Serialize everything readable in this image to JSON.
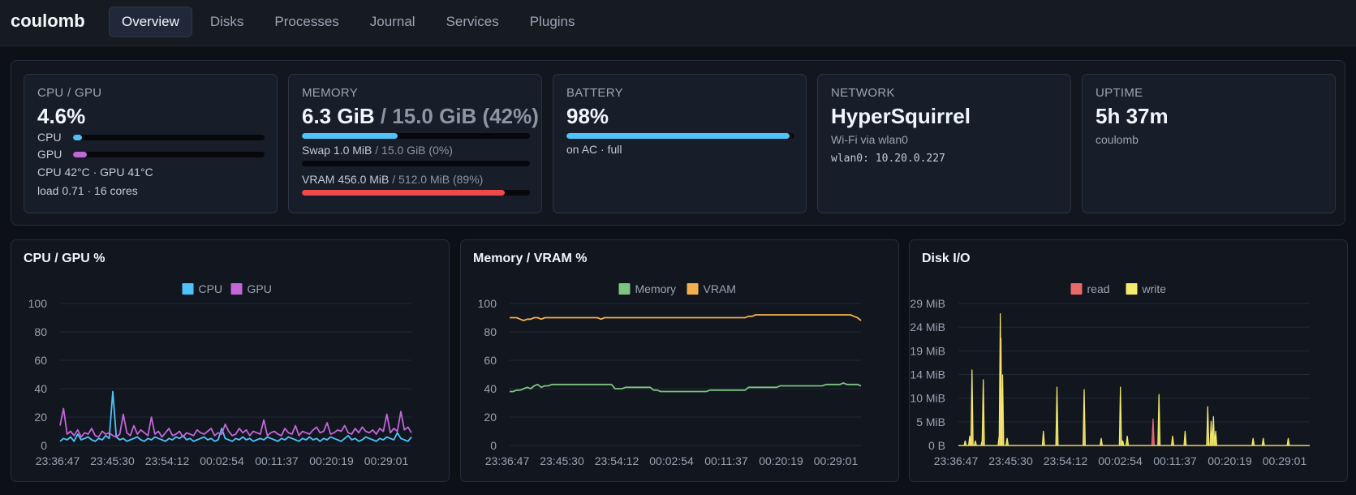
{
  "app": {
    "name": "coulomb"
  },
  "tabs": [
    {
      "label": "Overview",
      "active": true
    },
    {
      "label": "Disks"
    },
    {
      "label": "Processes"
    },
    {
      "label": "Journal"
    },
    {
      "label": "Services"
    },
    {
      "label": "Plugins"
    }
  ],
  "cpu_gpu": {
    "title": "CPU / GPU",
    "value": "4.6%",
    "cpu_label": "CPU",
    "cpu_fraction": 0.046,
    "gpu_label": "GPU",
    "gpu_fraction": 0.07,
    "temps": "CPU 42°C · GPU 41°C",
    "load": "load 0.71 · 16 cores"
  },
  "memory": {
    "title": "MEMORY",
    "used": "6.3 GiB",
    "total": "/ 15.0 GiB (42%)",
    "fraction": 0.42,
    "swap_used": "Swap 1.0 MiB",
    "swap_total": "/ 15.0 GiB (0%)",
    "swap_fraction": 0.0,
    "vram_used": "VRAM 456.0 MiB",
    "vram_total": "/ 512.0 MiB (89%)",
    "vram_fraction": 0.89
  },
  "battery": {
    "title": "BATTERY",
    "value": "98%",
    "fraction": 0.98,
    "status": "on AC · full"
  },
  "network": {
    "title": "NETWORK",
    "ssid": "HyperSquirrel",
    "via": "Wi-Fi via wlan0",
    "address": "wlan0: 10.20.0.227"
  },
  "uptime": {
    "title": "UPTIME",
    "value": "5h 37m",
    "host": "coulomb"
  },
  "colors": {
    "cpu": "#4fc3f7",
    "gpu": "#c266d8",
    "memory": "#7cc47f",
    "vram": "#f4b04d",
    "read": "#e86a6a",
    "write": "#f5ea6b",
    "vram_bar": "#ef4a4a"
  },
  "chart_data": [
    {
      "type": "line",
      "title": "CPU / GPU %",
      "x_ticks": [
        "23:36:47",
        "23:45:30",
        "23:54:12",
        "00:02:54",
        "00:11:37",
        "00:20:19",
        "00:29:01"
      ],
      "y_ticks": [
        "0",
        "20",
        "40",
        "60",
        "80",
        "100"
      ],
      "ylim": [
        0,
        100
      ],
      "legend_position": "top-center",
      "grid": true,
      "series": [
        {
          "name": "CPU",
          "color": "#4fc3f7",
          "values": [
            3,
            5,
            4,
            6,
            3,
            8,
            4,
            5,
            6,
            4,
            3,
            5,
            4,
            7,
            5,
            38,
            6,
            4,
            5,
            3,
            4,
            5,
            6,
            4,
            3,
            5,
            4,
            6,
            5,
            4,
            3,
            5,
            4,
            6,
            5,
            7,
            4,
            5,
            3,
            4,
            5,
            6,
            4,
            5,
            3,
            4,
            12,
            5,
            4,
            3,
            5,
            4,
            6,
            4,
            5,
            3,
            4,
            5,
            4,
            6,
            5,
            4,
            3,
            5,
            4,
            6,
            5,
            4,
            3,
            5,
            4,
            6,
            4,
            5,
            3,
            5,
            4,
            6,
            5,
            4,
            3,
            5,
            7,
            4,
            5,
            3,
            4,
            6,
            5,
            4,
            3,
            5,
            4,
            6,
            5,
            4,
            9,
            5,
            4,
            3,
            6
          ]
        },
        {
          "name": "GPU",
          "color": "#c266d8",
          "values": [
            14,
            26,
            8,
            10,
            7,
            11,
            6,
            9,
            8,
            12,
            7,
            6,
            10,
            8,
            9,
            7,
            6,
            8,
            22,
            9,
            7,
            14,
            8,
            11,
            9,
            7,
            20,
            8,
            10,
            6,
            9,
            12,
            7,
            8,
            10,
            6,
            9,
            8,
            7,
            11,
            9,
            8,
            10,
            12,
            7,
            9,
            8,
            15,
            10,
            7,
            8,
            12,
            9,
            11,
            7,
            10,
            9,
            8,
            18,
            7,
            9,
            10,
            8,
            7,
            12,
            9,
            8,
            14,
            7,
            10,
            9,
            8,
            11,
            13,
            9,
            10,
            16,
            8,
            9,
            11,
            10,
            14,
            9,
            8,
            12,
            9,
            13,
            10,
            9,
            11,
            8,
            12,
            10,
            22,
            9,
            12,
            10,
            24,
            11,
            13,
            9
          ]
        }
      ]
    },
    {
      "type": "line",
      "title": "Memory / VRAM %",
      "x_ticks": [
        "23:36:47",
        "23:45:30",
        "23:54:12",
        "00:02:54",
        "00:11:37",
        "00:20:19",
        "00:29:01"
      ],
      "y_ticks": [
        "0",
        "20",
        "40",
        "60",
        "80",
        "100"
      ],
      "ylim": [
        0,
        100
      ],
      "legend_position": "top-center",
      "grid": true,
      "series": [
        {
          "name": "Memory",
          "color": "#7cc47f",
          "values": [
            38,
            38,
            39,
            39,
            40,
            41,
            40,
            42,
            43,
            41,
            42,
            42,
            43,
            43,
            43,
            43,
            43,
            43,
            43,
            43,
            43,
            43,
            43,
            43,
            43,
            43,
            43,
            43,
            43,
            43,
            40,
            40,
            40,
            41,
            41,
            41,
            41,
            41,
            41,
            41,
            41,
            39,
            39,
            38,
            38,
            38,
            38,
            38,
            38,
            38,
            38,
            38,
            38,
            38,
            38,
            38,
            38,
            39,
            39,
            39,
            39,
            39,
            39,
            39,
            39,
            39,
            39,
            39,
            41,
            41,
            41,
            41,
            41,
            41,
            41,
            41,
            41,
            42,
            42,
            42,
            42,
            42,
            42,
            42,
            42,
            42,
            42,
            42,
            42,
            42,
            43,
            43,
            43,
            43,
            43,
            44,
            43,
            43,
            43,
            43,
            42
          ]
        },
        {
          "name": "VRAM",
          "color": "#f4b04d",
          "values": [
            90,
            90,
            90,
            89,
            88,
            89,
            89,
            90,
            90,
            89,
            90,
            90,
            90,
            90,
            90,
            90,
            90,
            90,
            90,
            90,
            90,
            90,
            90,
            90,
            90,
            90,
            89,
            90,
            90,
            90,
            90,
            90,
            90,
            90,
            90,
            90,
            90,
            90,
            90,
            90,
            90,
            90,
            90,
            90,
            90,
            90,
            90,
            90,
            90,
            90,
            90,
            90,
            90,
            90,
            90,
            90,
            90,
            90,
            90,
            90,
            90,
            90,
            90,
            90,
            90,
            90,
            90,
            90,
            91,
            91,
            92,
            92,
            92,
            92,
            92,
            92,
            92,
            92,
            92,
            92,
            92,
            92,
            92,
            92,
            92,
            92,
            92,
            92,
            92,
            92,
            92,
            92,
            92,
            92,
            92,
            92,
            92,
            92,
            91,
            90,
            88
          ]
        }
      ]
    },
    {
      "type": "area",
      "title": "Disk I/O",
      "x_ticks": [
        "23:36:47",
        "23:45:30",
        "23:54:12",
        "00:02:54",
        "00:11:37",
        "00:20:19",
        "00:29:01"
      ],
      "y_ticks": [
        "0 B",
        "5 MiB",
        "10 MiB",
        "14 MiB",
        "19 MiB",
        "24 MiB",
        "29 MiB"
      ],
      "ylim": [
        0,
        29
      ],
      "legend_position": "top-center",
      "grid": true,
      "series": [
        {
          "name": "read",
          "color": "#e86a6a",
          "values": [
            0,
            0,
            0,
            0,
            0,
            0,
            0,
            0,
            0,
            0,
            0,
            0,
            0,
            0,
            0,
            0,
            0,
            0,
            0,
            0,
            0,
            0,
            0,
            0,
            0,
            0,
            0,
            0,
            0,
            0,
            0,
            0,
            0,
            0,
            0,
            0,
            22,
            0,
            0,
            0,
            0,
            0,
            0,
            0,
            0,
            0,
            0,
            0,
            0,
            0,
            0,
            0,
            0,
            0,
            0,
            0,
            0,
            0,
            0,
            0,
            0,
            0,
            0,
            0,
            0,
            0,
            0,
            0,
            0,
            0,
            0,
            0,
            0,
            0,
            0,
            0,
            0,
            0,
            0,
            0,
            0,
            0,
            0,
            0,
            0,
            0,
            0,
            0,
            0,
            0,
            0,
            0,
            0,
            0,
            0,
            0,
            0,
            0,
            0,
            0,
            0,
            0,
            0,
            0,
            0,
            0,
            0,
            0,
            0,
            0,
            0,
            0,
            0,
            0,
            0,
            0,
            0,
            0,
            0,
            0,
            0,
            0,
            0,
            0,
            0,
            0,
            0,
            0,
            0,
            0,
            0,
            0,
            0,
            0,
            0,
            0,
            0,
            0,
            0,
            0,
            0,
            0,
            0,
            0,
            0,
            0,
            0,
            0,
            0,
            0,
            0,
            0,
            0,
            0,
            0,
            0,
            0,
            0,
            0,
            0,
            0,
            0,
            0,
            0,
            5.5,
            0,
            0,
            0,
            0,
            0,
            0,
            0,
            0,
            0,
            0,
            0,
            0,
            0,
            0,
            0,
            0,
            0,
            0,
            0,
            0,
            0,
            0,
            0,
            0,
            0,
            0,
            0,
            0,
            0,
            0,
            0,
            0,
            0,
            0,
            0,
            0,
            0,
            0,
            0,
            0,
            0,
            0,
            0,
            0,
            0,
            0,
            0,
            0,
            0,
            0,
            0,
            0,
            0,
            0,
            0,
            0,
            0,
            0,
            0,
            0,
            0,
            0,
            0,
            0,
            0,
            0,
            0,
            0,
            0,
            0,
            0,
            0,
            0,
            0,
            0,
            0,
            0,
            0,
            0,
            0,
            0,
            0,
            0,
            0,
            0,
            0,
            0,
            0,
            0,
            0,
            0,
            0,
            0,
            0,
            0,
            0,
            0,
            0,
            0,
            0,
            0,
            0,
            0,
            0,
            0,
            0,
            0,
            0,
            0,
            0,
            0,
            0,
            0,
            0,
            0,
            0,
            0,
            0,
            0,
            0,
            0,
            0,
            0,
            0,
            0,
            0,
            0,
            0,
            0,
            0,
            0,
            0
          ]
        },
        {
          "name": "write",
          "color": "#f5ea6b",
          "values": [
            0,
            0,
            0,
            0,
            0,
            0,
            1,
            0,
            0,
            0,
            2,
            0,
            15.5,
            0,
            0,
            1,
            0,
            0,
            0,
            0,
            0,
            1,
            13.5,
            0,
            0,
            0,
            0,
            0,
            0,
            0,
            0,
            0,
            0,
            0,
            0,
            0,
            2,
            27,
            0,
            14.5,
            0,
            0,
            0,
            1.5,
            0,
            0,
            0,
            0,
            0,
            0,
            0,
            0,
            0,
            0,
            0,
            0,
            0,
            0,
            0,
            0,
            0,
            0,
            0,
            0,
            0,
            0,
            0,
            0,
            0,
            0,
            0,
            0,
            0,
            0,
            0,
            3,
            0,
            0,
            0,
            0,
            0,
            0,
            0,
            0,
            0,
            0,
            0,
            12,
            0,
            0,
            0,
            0,
            0,
            0,
            0,
            0,
            0,
            0,
            0,
            0,
            0,
            0,
            0,
            0,
            0,
            0,
            0,
            0,
            0,
            0,
            0,
            11.5,
            0,
            0,
            0,
            0,
            0,
            0,
            0,
            0,
            0,
            0,
            0,
            0,
            0,
            0,
            1.5,
            0,
            0,
            0,
            0,
            0,
            0,
            0,
            0,
            0,
            0,
            0,
            0,
            0,
            0,
            0,
            0,
            12,
            0,
            1,
            0,
            0,
            0,
            2,
            0,
            0,
            0,
            0,
            0,
            0,
            0,
            0,
            0,
            0,
            0,
            0,
            0,
            0,
            0,
            0,
            0,
            0,
            0,
            0,
            0,
            0,
            0,
            0,
            0,
            0,
            0,
            10.5,
            0,
            0,
            0,
            0,
            0,
            0,
            0,
            0,
            0,
            0,
            0,
            2,
            0,
            0,
            0,
            0,
            0,
            0,
            0,
            0,
            0,
            0,
            3,
            0,
            0,
            0,
            0,
            0,
            0,
            0,
            0,
            0,
            0,
            0,
            0,
            0,
            0,
            0,
            0,
            0,
            0,
            0,
            8,
            0,
            0,
            5,
            0,
            6,
            0,
            3,
            0,
            0,
            0,
            0,
            0,
            0,
            0,
            0,
            0,
            0,
            0,
            0,
            0,
            0,
            0,
            0,
            0,
            0,
            0,
            0,
            0,
            0,
            0,
            0,
            0,
            0,
            0,
            0,
            0,
            0,
            0,
            0,
            1.5,
            0,
            0,
            0,
            0,
            0,
            0,
            0,
            0,
            1.5,
            0,
            0,
            0,
            0,
            0,
            0,
            0,
            0,
            0,
            0,
            0,
            0,
            0,
            0,
            0,
            0,
            0,
            0,
            0,
            0,
            0,
            1.5,
            0,
            0,
            0,
            0,
            0,
            0,
            0,
            0,
            0,
            0,
            0,
            0,
            0,
            0,
            0,
            0,
            0,
            0,
            0
          ]
        }
      ]
    }
  ]
}
